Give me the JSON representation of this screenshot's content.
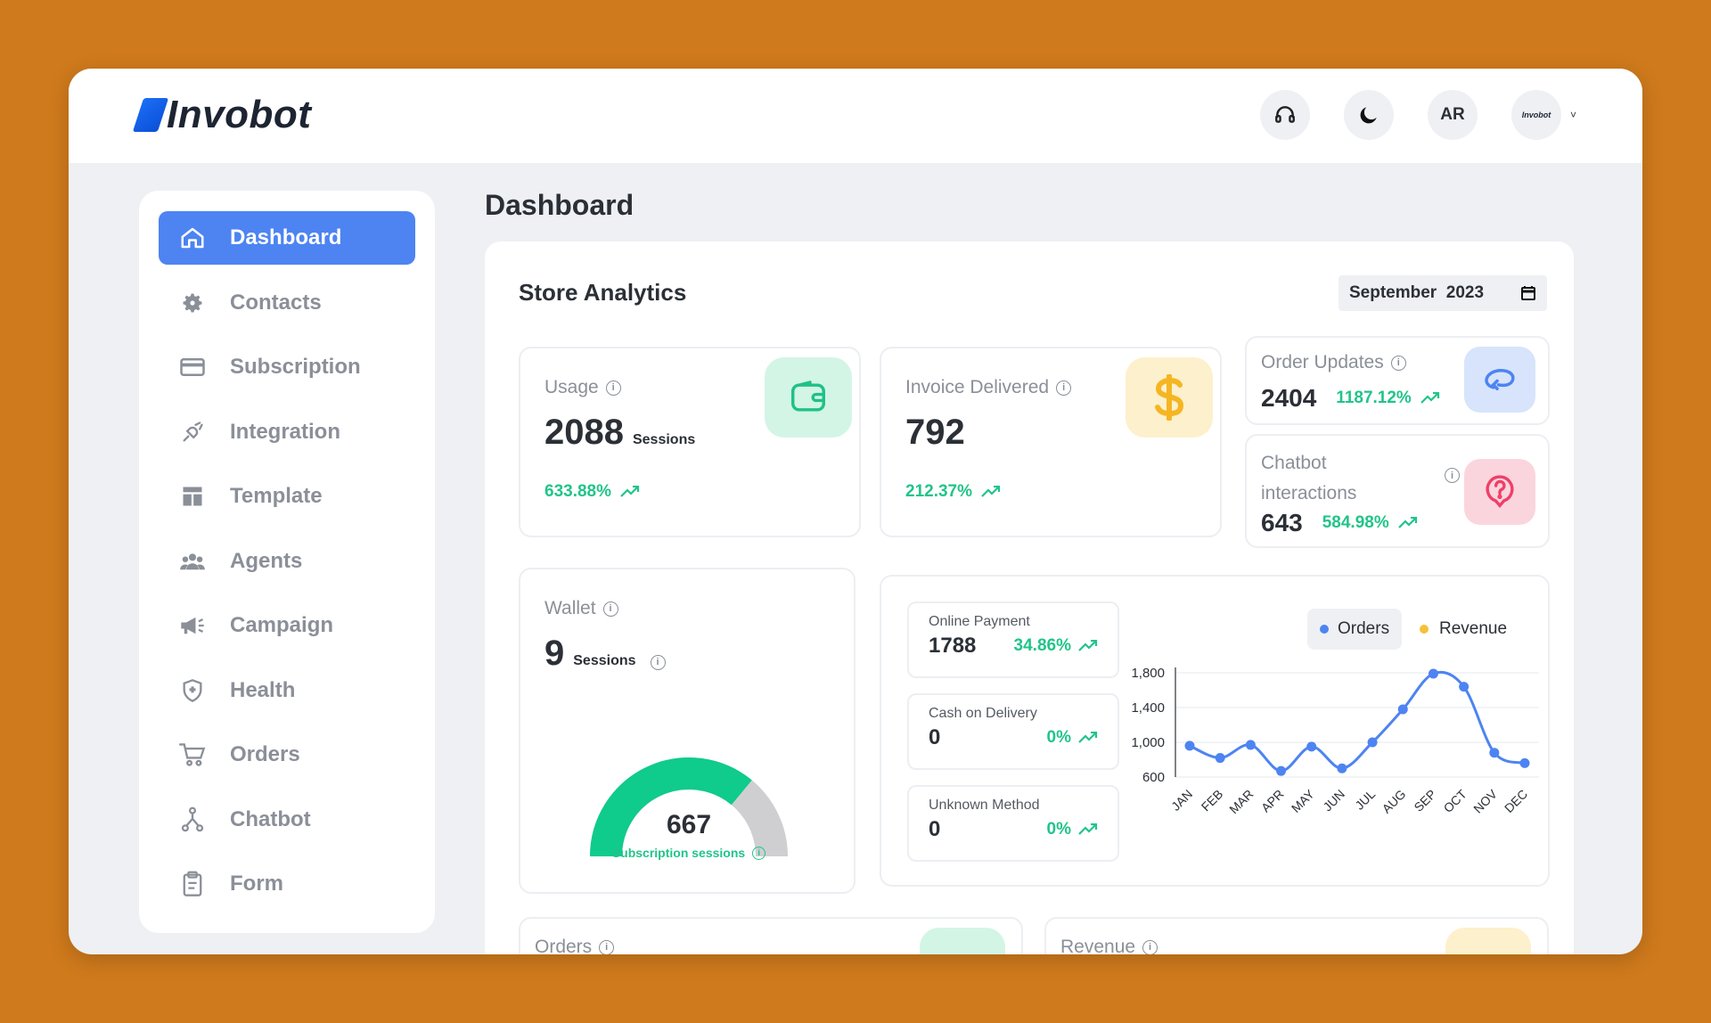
{
  "brand": {
    "name": "Invobot",
    "avatar_text": "Invobot"
  },
  "header": {
    "language_button": "AR"
  },
  "sidebar": {
    "items": [
      {
        "label": "Dashboard",
        "icon": "home-icon",
        "active": true
      },
      {
        "label": "Contacts",
        "icon": "gear-icon"
      },
      {
        "label": "Subscription",
        "icon": "card-icon"
      },
      {
        "label": "Integration",
        "icon": "plug-icon"
      },
      {
        "label": "Template",
        "icon": "layout-icon"
      },
      {
        "label": "Agents",
        "icon": "users-icon"
      },
      {
        "label": "Campaign",
        "icon": "megaphone-icon"
      },
      {
        "label": "Health",
        "icon": "shield-icon"
      },
      {
        "label": "Orders",
        "icon": "cart-icon"
      },
      {
        "label": "Chatbot",
        "icon": "network-icon"
      },
      {
        "label": "Form",
        "icon": "clipboard-icon"
      }
    ]
  },
  "page": {
    "title": "Dashboard"
  },
  "analytics": {
    "title": "Store Analytics",
    "date": "September  2023",
    "usage": {
      "label": "Usage",
      "value": "2088",
      "unit": "Sessions",
      "trend": "633.88%"
    },
    "invoice": {
      "label": "Invoice Delivered",
      "value": "792",
      "trend": "212.37%"
    },
    "order_updates": {
      "label": "Order Updates",
      "value": "2404",
      "trend": "1187.12%"
    },
    "chatbot": {
      "label_line1": "Chatbot",
      "label_line2": "interactions",
      "value": "643",
      "trend": "584.98%"
    },
    "wallet": {
      "label": "Wallet",
      "value": "9",
      "unit": "Sessions",
      "gauge_value": "667",
      "gauge_label": "Subscription sessions",
      "gauge_fraction": 0.72
    },
    "payments": [
      {
        "label": "Online Payment",
        "value": "1788",
        "pct": "34.86%"
      },
      {
        "label": "Cash on Delivery",
        "value": "0",
        "pct": "0%"
      },
      {
        "label": "Unknown Method",
        "value": "0",
        "pct": "0%"
      }
    ],
    "bottom": {
      "orders_label": "Orders",
      "revenue_label": "Revenue"
    }
  },
  "colors": {
    "accent": "#4d84f2",
    "green": "#21c48a",
    "orders": "#4d84f2",
    "revenue": "#f5c13a"
  },
  "chart_data": {
    "type": "line",
    "categories": [
      "JAN",
      "FEB",
      "MAR",
      "APR",
      "MAY",
      "JUN",
      "JUL",
      "AUG",
      "SEP",
      "OCT",
      "NOV",
      "DEC"
    ],
    "series": [
      {
        "name": "Orders",
        "values": [
          960,
          820,
          970,
          670,
          950,
          700,
          1000,
          1380,
          1790,
          1640,
          880,
          760
        ]
      },
      {
        "name": "Revenue",
        "values": []
      }
    ],
    "yticks": [
      "1,800",
      "1,400",
      "1,000",
      "600"
    ],
    "ylim": [
      600,
      1800
    ],
    "legend": "top-right",
    "grid": true
  }
}
